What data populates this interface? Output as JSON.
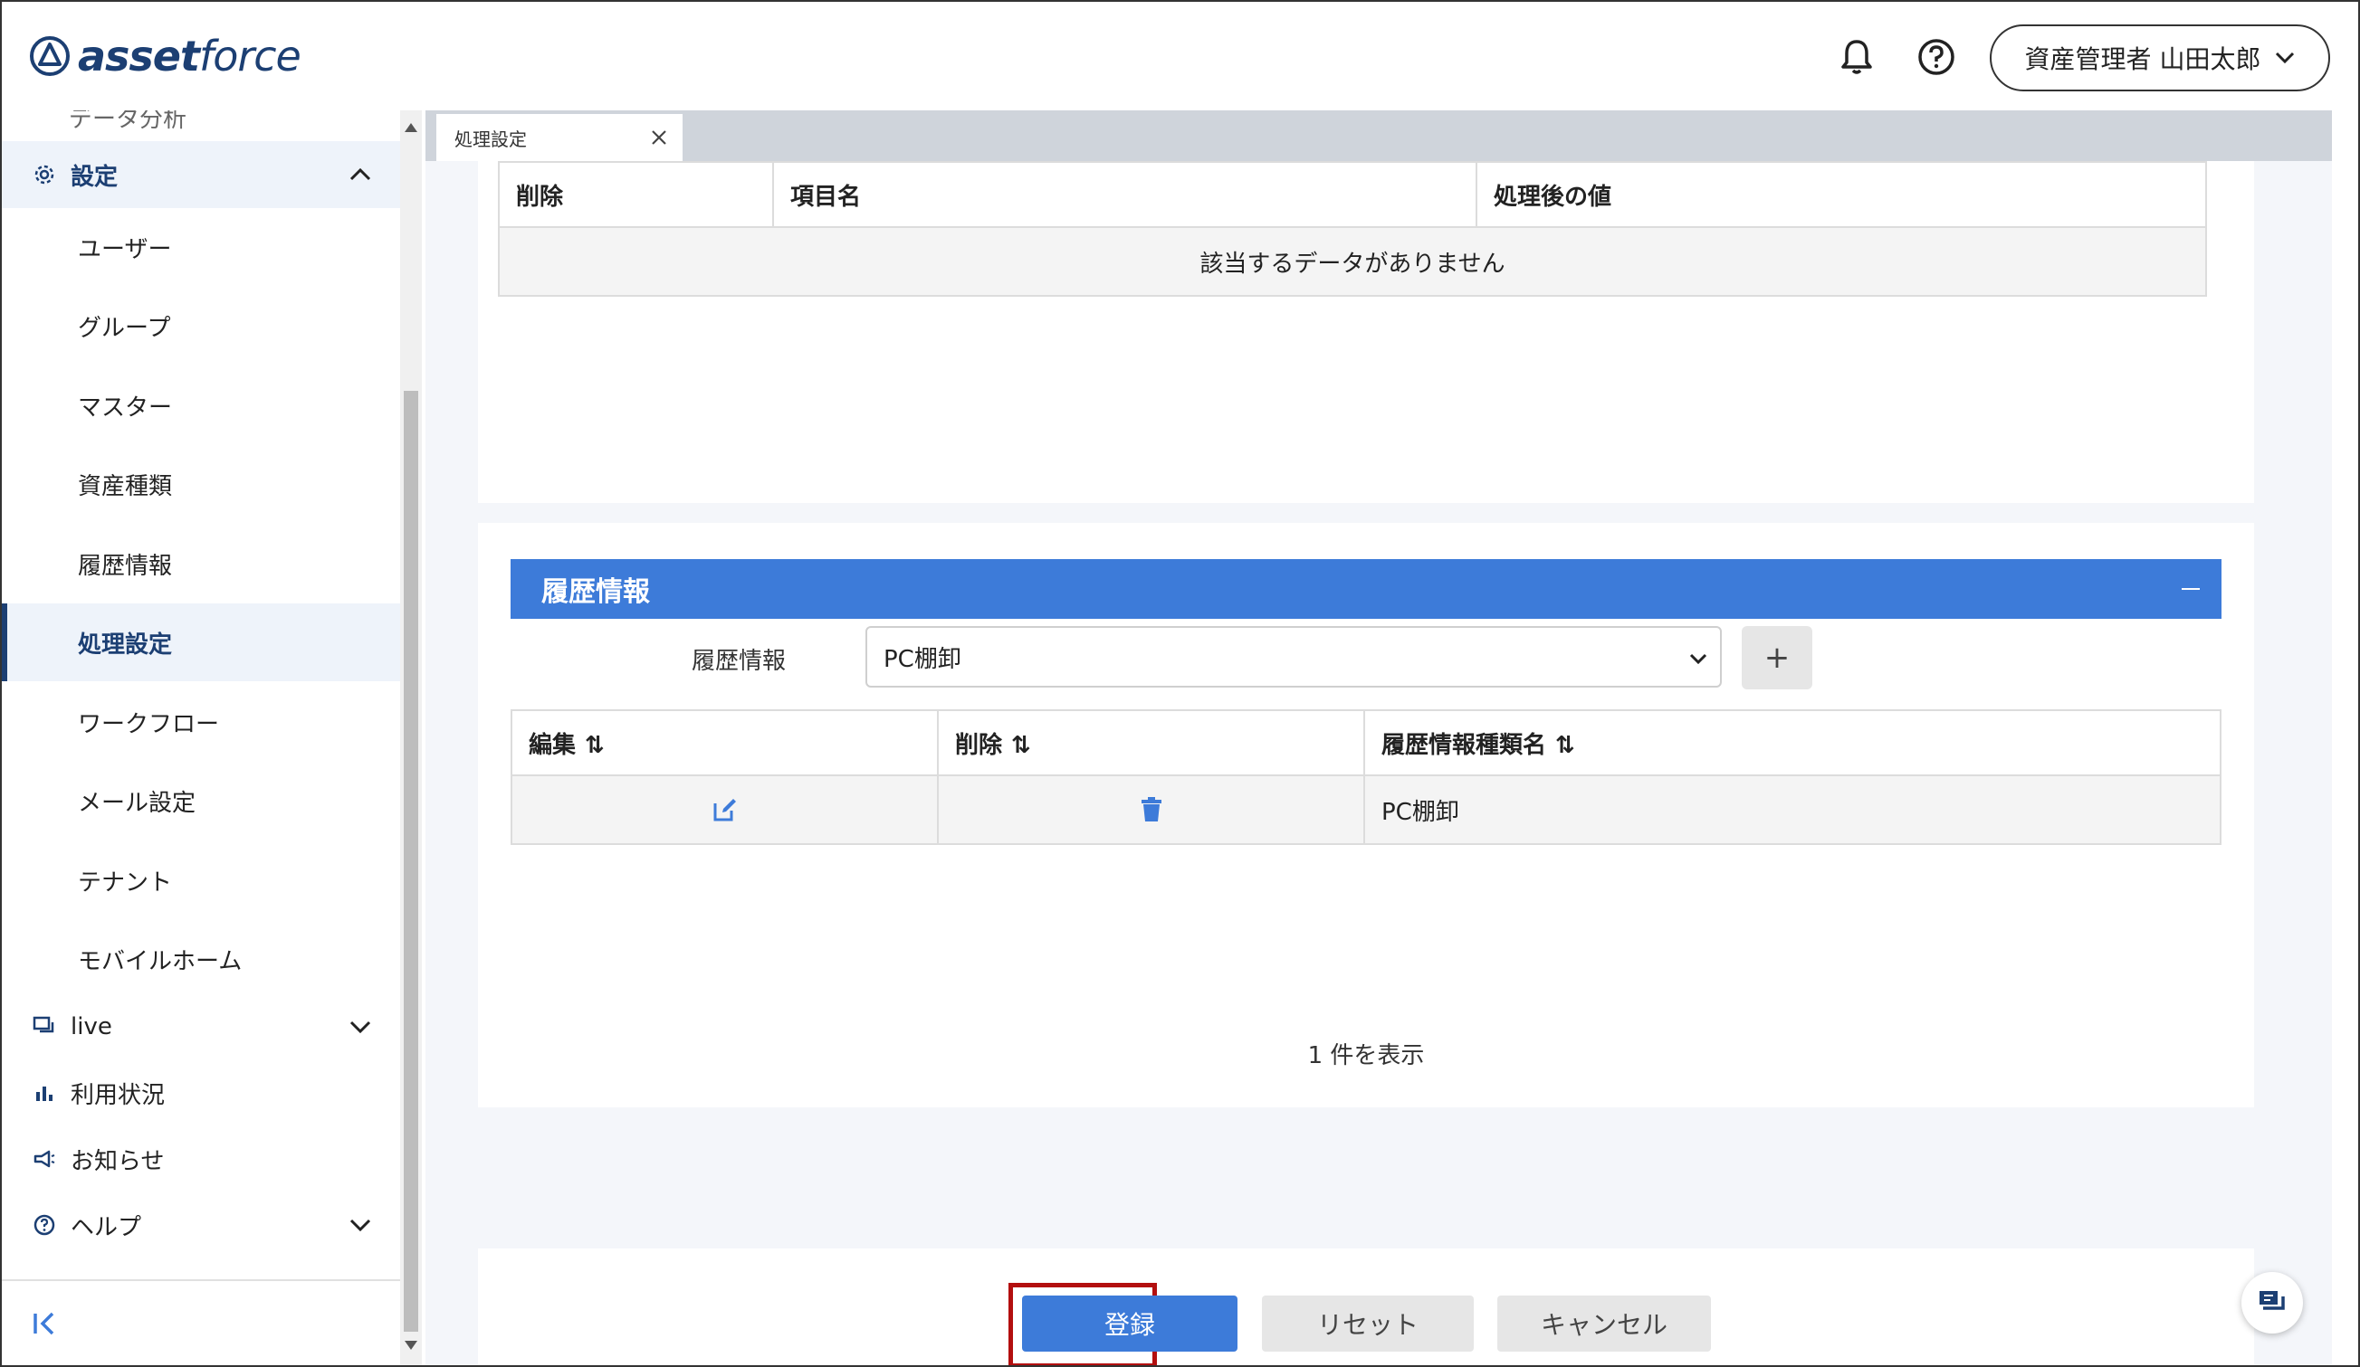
{
  "app": {
    "logo_text_bold": "asset",
    "logo_text_light": "force",
    "user_label": "資産管理者 山田太郎"
  },
  "sidebar": {
    "clipped_item": "データ分析",
    "settings_label": "設定",
    "settings_children": [
      "ユーザー",
      "グループ",
      "マスター",
      "資産種類",
      "履歴情報",
      "処理設定",
      "ワークフロー",
      "メール設定",
      "テナント",
      "モバイルホーム"
    ],
    "active_child": "処理設定",
    "live_label": "live",
    "usage_label": "利用状況",
    "news_label": "お知らせ",
    "help_label": "ヘルプ"
  },
  "tabs": [
    {
      "label": "処理設定"
    }
  ],
  "delete_table": {
    "headers": [
      "削除",
      "項目名",
      "処理後の値"
    ],
    "empty_message": "該当するデータがありません"
  },
  "history_panel": {
    "title": "履歴情報",
    "field_label": "履歴情報",
    "selected_value": "PC棚卸",
    "add_button": "+",
    "headers": [
      "編集",
      "削除",
      "履歴情報種類名"
    ],
    "rows": [
      {
        "type_name": "PC棚卸"
      }
    ],
    "count_text": "1 件を表示"
  },
  "actions": {
    "register": "登録",
    "reset": "リセット",
    "cancel": "キャンセル"
  },
  "colors": {
    "brand": "#1c3f73",
    "primary": "#3d7bd9",
    "highlight": "#b30f0f"
  }
}
